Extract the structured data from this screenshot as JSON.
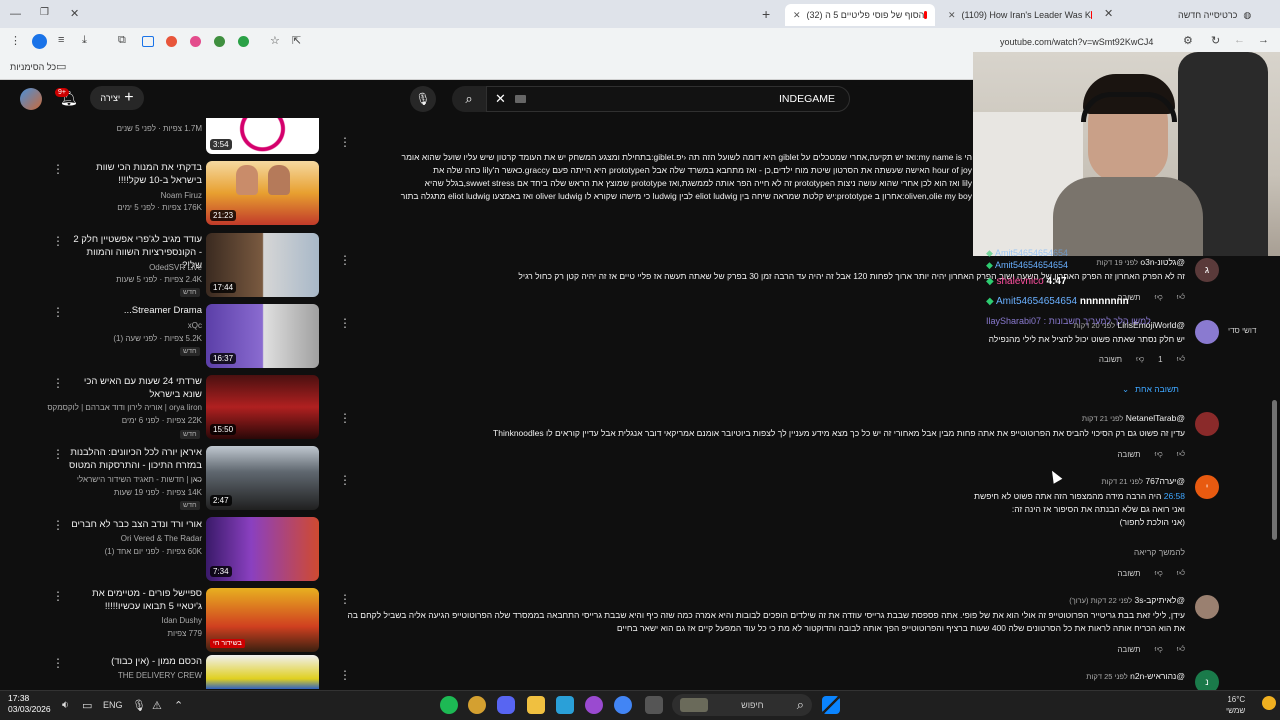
{
  "browser": {
    "tabs": [
      {
        "label": "כרטיסייה חדשה"
      },
      {
        "label": "(1109) How Iran's Leader Was K"
      },
      {
        "label": "(32) הסוף של פוסי פליטיים 5 ה"
      }
    ],
    "url": "youtube.com/watch?v=wSmt92KwCJ4",
    "bookmarks_label": "כל הסימניות"
  },
  "youtube": {
    "search_value": "INDEGAME",
    "create_label": "יצירה",
    "notif_count": "9+"
  },
  "feed": [
    {
      "title": "",
      "channel": "",
      "meta": "1.7M צפיות · לפני 5 שנים",
      "duration": "3:54",
      "badge": ""
    },
    {
      "title": "בדקתי את המנות הכי שוות בישראל ב-10 שקל!!!!",
      "channel": "Noam Firuz",
      "meta": "176K צפיות · לפני 5 ימים",
      "duration": "21:23",
      "badge": ""
    },
    {
      "title": "עודד מגיב לג'פרי אפשטיין חלק 2 - הקונספירציות השווה והמוות של!?",
      "channel": "OdedSVR Live",
      "meta": "2.4K צפיות · לפני 5 שעות",
      "duration": "17:44",
      "badge": "חדש"
    },
    {
      "title": "Streamer Drama...",
      "channel": "xQc",
      "meta": "5.2K צפיות · לפני שעה (1)",
      "duration": "16:37",
      "badge": "חדש"
    },
    {
      "title": "שרדתי 24 שעות עם האיש הכי שונא בישראל",
      "channel": "orya liron | אוריה לירון ודוד אברהם | לוקסמקס",
      "meta": "22K צפיות · לפני 6 ימים",
      "duration": "15:50",
      "badge": "חדש"
    },
    {
      "title": "איראן יורה לכל הכיוונים: ההלבנות במזרח התיכון - והתרסקות המטוס ...",
      "channel": "כאן | חדשות - תאגיד השידור הישראלי",
      "meta": "14K צפיות · לפני 19 שעות",
      "duration": "2:47",
      "badge": "חדש"
    },
    {
      "title": "אורי ורד ונדב הצב כבר לא חברים",
      "channel": "Ori Vered & The Radar",
      "meta": "60K צפיות · לפני יום אחד (1)",
      "duration": "7:34",
      "badge": ""
    },
    {
      "title": "ספיישל פורים - מטיימים את ג'יטאיי 5 תבואו עכשיו!!!!!",
      "channel": "Idan Dushy",
      "meta": "779 צפיות",
      "duration": "",
      "badge": "בשידור חי"
    },
    {
      "title": "הכסם ממון - (אין כבוד)",
      "channel": "THE DELIVERY CREW",
      "meta": "",
      "duration": "",
      "badge": ""
    }
  ],
  "comments": {
    "top_text": [
      "הי my name is:ואז יש תקיעה,אחרי שמטכלים על giblet היא דומה לשועל הזה תה ‹יפ.giblet:בתחילת ומצגע המשחק יש את העומד קרטון שיש עליו שועל שהוא אומר",
      "hour of joy האישה שעשתה את הסרטון שיטת מוח ילדים,כן - ואז מתחבא במשרד שלה אבל הprototype היא הייתה פעם graccy.כאשר ה'lily כחה שלה את",
      "lily ואז הוא לכן אחרי שהוא עושה ניצות הprototype זה לא חייה הפר אותה לממשגת,ואז prototype שמוצץ את הראש שלה ביחד אם swwet stress,בגלל שהיא",
      "oliven,olie my boy:אחרון ב prototype:יש קלטת שמראה שיחה בין eliot ludwig לבין ludwig כי מישהו שקורא לו oliver ludwig ואז באמצעו eliot ludwig מתגלה בתור"
    ],
    "items": [
      {
        "author": "@גלטונ-o3n",
        "time": "לפני 19 דקות",
        "text": "זה לא הפרק האחרון זה הפרק האחרון של השעה ושוב הפרק האחרון יהיה יותר ארוך לפחות 120 אבל זה יהיה עד הרבה זמן 30 בפרק של שאתה תעשה אז פליי טיים אז זה יהיה קטן רק כחול רגיל",
        "likes": "",
        "reply": "תשובה"
      },
      {
        "author": "@LirisEmojiWorld",
        "time": "לפני 20 דקות",
        "text": "יש חלק נסתר שאתה פשוט יכול להציל את לילי מהנפילה",
        "likes": "1",
        "reply": "תשובה"
      },
      {
        "author": "@NetanelTarab",
        "time": "לפני 21 דקות",
        "text": "עדין זה פשוט גם רק הסיכוי להביס את הפרוטוטייפ את אתה פחות מבין אבל מאחורי זה יש כל כך מצא מידע מעניין לך לצפות ביוטיובר אומנם אמריקאי  דובר אנגלית אבל עדיין קוראים לו Thinknoodles",
        "likes": "",
        "reply": "תשובה"
      },
      {
        "author": "@יערה767",
        "time": "לפני 21 דקות",
        "link": "26:58",
        "lines": [
          "היה הרבה מידה מהמצפור הזה אתה פשוט לא חיפשת",
          "ואני רואה גם שלא הבנתה את הסיפור אז הינה זה:",
          "(אני הולכת לחפור)"
        ],
        "more": "להמשך קריאה",
        "reply": "תשובה"
      },
      {
        "author": "@לאיתיקב-3s",
        "time": "לפני 22 דקות (ערוך)",
        "lines": [
          "עידן, לילי זאת בבת גריטייר הפרוטוטייפ זה אולי הוא את של פופי. אתה פספסת שבבת גרייסי עוזדה את זה שילדים הופכים לבובות והיא אמרה כמה שזה כיף והיא שבבת גרייסי התחבאה בממסרד שלה הפרוטוטייפ הגיעה אליה בשביל לקחם בה",
          "את הוא הכריח אותה לראות את כל הסרטונים שלה 400 שעות ברציף והפרוטוטייפ הפך אותה לבובה והדוקטור לא מת כי כל עוד המפעל קיים אז גם הוא ישאר בחיים"
        ],
        "reply": "תשובה"
      },
      {
        "author": "@נהוראיש-n2n",
        "time": "לפני 25 דקות"
      }
    ],
    "replies_toggle": "תשובה אחת",
    "reply_label": "תשובה"
  },
  "stream_overlay": {
    "chat": [
      {
        "user": "Amit54654654654",
        "msg": ""
      },
      {
        "user": "shalevnico",
        "msg": "4:47"
      },
      {
        "user": "Amit54654654654",
        "msg": "nnnnnnnn"
      },
      {
        "user": "IlaySharabi07",
        "msg": "למשו הלך למעריך חשבונות :"
      }
    ],
    "side_label": "דושי סדי"
  },
  "taskbar": {
    "time": "17:38",
    "date": "03/03/2026",
    "lang": "ENG",
    "search": "חיפוש",
    "temp": "16°C",
    "weather": "שמשי"
  },
  "colors": {
    "youtube_red": "#ff0000",
    "link_blue": "#3ea6ff",
    "bg": "#0f0f0f"
  }
}
